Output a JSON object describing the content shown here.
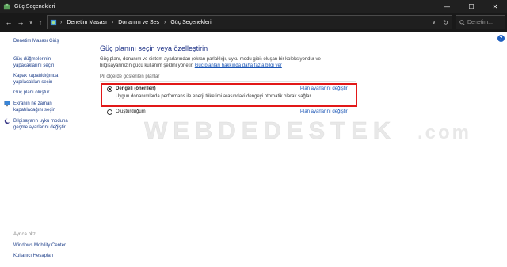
{
  "window": {
    "title": "Güç Seçenekleri",
    "minimize_glyph": "—",
    "maximize_glyph": "☐",
    "close_glyph": "✕"
  },
  "addressbar": {
    "back_glyph": "←",
    "forward_glyph": "→",
    "up_glyph": "↑",
    "dropdown_glyph": "∨",
    "breadcrumb": [
      "Denetim Masası",
      "Donanım ve Ses",
      "Güç Seçenekleri"
    ],
    "separator": "›",
    "refresh_glyph": "↻",
    "search_placeholder": "Denetim..."
  },
  "sidebar": {
    "home_link": "Denetim Masası Giriş",
    "tasks": [
      {
        "label": "Güç düğmelerinin yapacaklarını seçin",
        "lines": [
          "Güç düğmelerinin",
          "yapacaklarını seçin"
        ],
        "icon": null
      },
      {
        "label": "Kapak kapatıldığında yapılacakları seçin",
        "lines": [
          "Kapak kapatıldığında",
          "yapılacakları seçin"
        ],
        "icon": null
      },
      {
        "label": "Güç planı oluştur",
        "lines": [
          "Güç planı oluştur"
        ],
        "icon": null
      },
      {
        "label": "Ekranın ne zaman kapatılacağını seçin",
        "lines": [
          "Ekranın ne zaman",
          "kapatılacağını seçin"
        ],
        "icon": "monitor-icon"
      },
      {
        "label": "Bilgisayarın uyku moduna geçme ayarlarını değiştir",
        "lines": [
          "Bilgisayarın uyku moduna",
          "geçme ayarlarını değiştir"
        ],
        "icon": "moon-icon"
      }
    ],
    "see_also_label": "Ayrıca bkz.",
    "see_also": [
      "Windows Mobility Center",
      "Kullanıcı Hesapları"
    ]
  },
  "main": {
    "heading": "Güç planını seçin veya özelleştirin",
    "description": "Güç planı, donanım ve sistem ayarlarından (ekran parlaklığı, uyku modu gibi) oluşan bir koleksiyondur ve bilgisayarınızın gücü kullanım şeklini yönetir.",
    "description_lines": [
      "Güç planı, donanım ve sistem ayarlarından (ekran parlaklığı, uyku modu gibi) oluşan bir koleksiyondur ve",
      "bilgisayarınızın gücü kullanım şeklini yönetir."
    ],
    "description_link": "Güç planları hakkında daha fazla bilgi ver",
    "section_label": "Pil ölçerde gösterilen planlar",
    "plans": [
      {
        "name": "Dengeli (önerilen)",
        "selected": true,
        "change_link": "Plan ayarlarını değiştir",
        "description": "Uygun donanımlarda performans ile enerji tüketimi arasındaki dengeyi otomatik olarak sağlar."
      },
      {
        "name": "Oluşturduğum",
        "selected": false,
        "change_link": "Plan ayarlarını değiştir",
        "description": ""
      }
    ],
    "help_glyph": "?"
  },
  "watermark": "WEBDEDESTEK.com",
  "colors": {
    "titlebar": "#202020",
    "addressbar": "#191919",
    "link": "#1e3f8a",
    "heading": "#1e3287",
    "highlight_box": "#e21818"
  }
}
